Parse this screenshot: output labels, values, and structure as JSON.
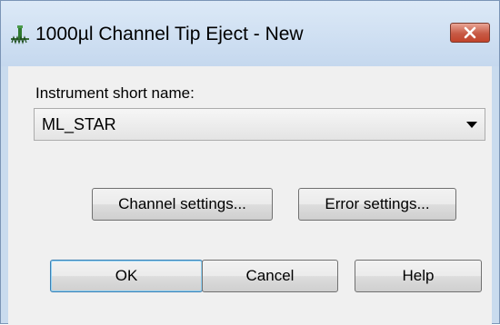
{
  "window": {
    "title": "1000µl Channel Tip Eject - New",
    "close_glyph": "✕"
  },
  "form": {
    "instrument_label": "Instrument short name:",
    "instrument_value": "ML_STAR"
  },
  "buttons": {
    "channel_settings": "Channel settings...",
    "error_settings": "Error settings...",
    "ok": "OK",
    "cancel": "Cancel",
    "help": "Help"
  },
  "icons": {
    "app": "channel-tip-eject-icon",
    "close": "close-icon",
    "dropdown": "chevron-down-icon"
  },
  "colors": {
    "title_bar": "#c9dbee",
    "close_button": "#c75a45",
    "client_bg": "#f0f0f0",
    "default_button_border": "#3c7fb1"
  }
}
